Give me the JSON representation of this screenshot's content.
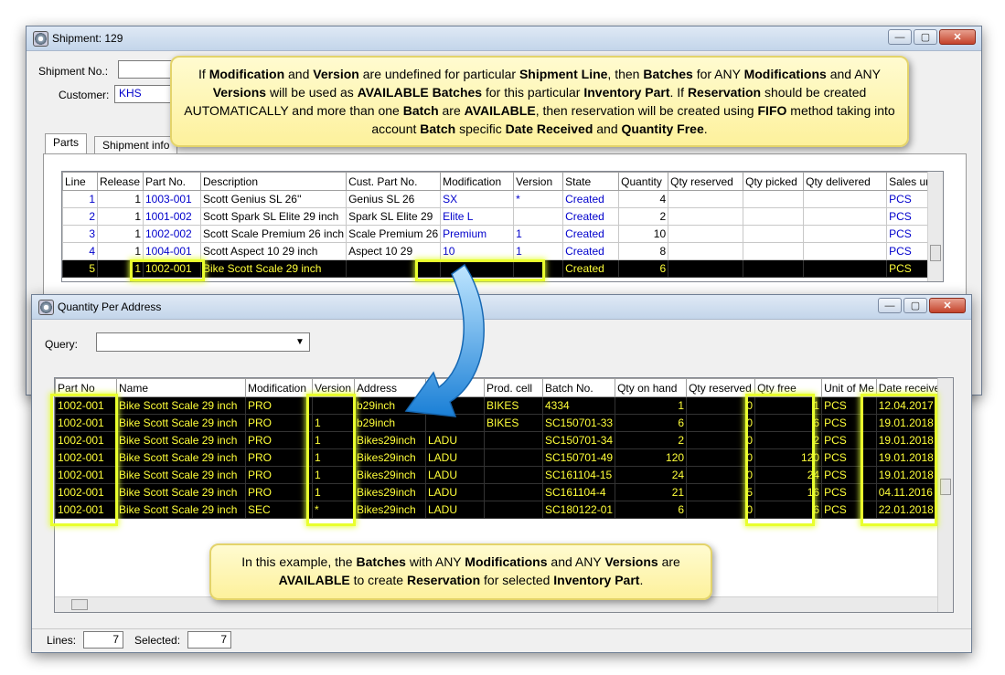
{
  "shipment": {
    "title": "Shipment: 129",
    "shipment_no_label": "Shipment No.:",
    "shipment_no_value": "129",
    "customer_label": "Customer:",
    "customer_value": "KHS",
    "tabs": [
      "Parts",
      "Shipment info"
    ],
    "columns": [
      "Line",
      "Release",
      "Part No.",
      "Description",
      "Cust. Part No.",
      "Modification",
      "Version",
      "State",
      "Quantity",
      "Qty reserved",
      "Qty picked",
      "Qty delivered",
      "Sales unit"
    ],
    "rows": [
      {
        "line": "1",
        "release": "1",
        "part": "1003-001",
        "desc": "Scott Genius SL 26''",
        "cust": "Genius SL 26",
        "mod": "SX",
        "ver": "*",
        "state": "Created",
        "qty": "4",
        "unit": "PCS"
      },
      {
        "line": "2",
        "release": "1",
        "part": "1001-002",
        "desc": "Scott Spark SL Elite 29 inch",
        "cust": "Spark SL Elite 29",
        "mod": "Elite L",
        "ver": "",
        "state": "Created",
        "qty": "2",
        "unit": "PCS"
      },
      {
        "line": "3",
        "release": "1",
        "part": "1002-002",
        "desc": "Scott Scale Premium 26 inch",
        "cust": "Scale Premium 26",
        "mod": "Premium",
        "ver": "1",
        "state": "Created",
        "qty": "10",
        "unit": "PCS"
      },
      {
        "line": "4",
        "release": "1",
        "part": "1004-001",
        "desc": "Scott Aspect 10 29 inch",
        "cust": "Aspect 10 29",
        "mod": "10",
        "ver": "1",
        "state": "Created",
        "qty": "8",
        "unit": "PCS"
      },
      {
        "line": "5",
        "release": "1",
        "part": "1002-001",
        "desc": "Bike Scott Scale 29 inch",
        "cust": "",
        "mod": "",
        "ver": "",
        "state": "Created",
        "qty": "6",
        "unit": "PCS"
      }
    ]
  },
  "qpa": {
    "title": "Quantity Per Address",
    "query_label": "Query:",
    "query_value": "",
    "columns": [
      "Part No",
      "Name",
      "Modification",
      "Version",
      "Address",
      "",
      "Prod. cell",
      "Batch No.",
      "Qty on hand",
      "Qty reserved",
      "Qty free",
      "Unit of Me",
      "Date received"
    ],
    "rows": [
      {
        "part": "1002-001",
        "name": "Bike Scott Scale 29 inch",
        "mod": "PRO",
        "ver": "",
        "addr": "b29inch",
        "loc": "",
        "cell": "BIKES",
        "batch": "4334",
        "onhand": "1",
        "res": "0",
        "free": "1",
        "unit": "PCS",
        "date": "12.04.2017"
      },
      {
        "part": "1002-001",
        "name": "Bike Scott Scale 29 inch",
        "mod": "PRO",
        "ver": "1",
        "addr": "b29inch",
        "loc": "",
        "cell": "BIKES",
        "batch": "SC150701-33",
        "onhand": "6",
        "res": "0",
        "free": "6",
        "unit": "PCS",
        "date": "19.01.2018"
      },
      {
        "part": "1002-001",
        "name": "Bike Scott Scale 29 inch",
        "mod": "PRO",
        "ver": "1",
        "addr": "Bikes29inch",
        "loc": "LADU",
        "cell": "",
        "batch": "SC150701-34",
        "onhand": "2",
        "res": "0",
        "free": "2",
        "unit": "PCS",
        "date": "19.01.2018"
      },
      {
        "part": "1002-001",
        "name": "Bike Scott Scale 29 inch",
        "mod": "PRO",
        "ver": "1",
        "addr": "Bikes29inch",
        "loc": "LADU",
        "cell": "",
        "batch": "SC150701-49",
        "onhand": "120",
        "res": "0",
        "free": "120",
        "unit": "PCS",
        "date": "19.01.2018"
      },
      {
        "part": "1002-001",
        "name": "Bike Scott Scale 29 inch",
        "mod": "PRO",
        "ver": "1",
        "addr": "Bikes29inch",
        "loc": "LADU",
        "cell": "",
        "batch": "SC161104-15",
        "onhand": "24",
        "res": "0",
        "free": "24",
        "unit": "PCS",
        "date": "19.01.2018"
      },
      {
        "part": "1002-001",
        "name": "Bike Scott Scale 29 inch",
        "mod": "PRO",
        "ver": "1",
        "addr": "Bikes29inch",
        "loc": "LADU",
        "cell": "",
        "batch": "SC161104-4",
        "onhand": "21",
        "res": "5",
        "free": "16",
        "unit": "PCS",
        "date": "04.11.2016"
      },
      {
        "part": "1002-001",
        "name": "Bike Scott Scale 29 inch",
        "mod": "SEC",
        "ver": "*",
        "addr": "Bikes29inch",
        "loc": "LADU",
        "cell": "",
        "batch": "SC180122-01",
        "onhand": "6",
        "res": "0",
        "free": "6",
        "unit": "PCS",
        "date": "22.01.2018"
      }
    ],
    "lines_label": "Lines:",
    "lines_value": "7",
    "selected_label": "Selected:",
    "selected_value": "7"
  },
  "callout_top": {
    "p1": "If ",
    "b1": "Modification",
    "p2": " and ",
    "b2": "Version",
    "p3": " are undefined for particular ",
    "b3": "Shipment Line",
    "p4": ", then ",
    "b4": "Batches",
    "p5": " for ANY ",
    "b5": "Modifications",
    "p6": " and ANY ",
    "b6": "Versions",
    "p7": " will be used as ",
    "b7": "AVAILABLE Batches",
    "p8": " for this particular ",
    "b8": "Inventory Part",
    "p9": ". If ",
    "b9": "Reservation",
    "p10": " should be created AUTOMATICALLY and more than one ",
    "b10": "Batch",
    "p11": " are ",
    "b11": "AVAILABLE",
    "p12": ", then reservation will be created using ",
    "b12": "FIFO",
    "p13": " method taking into account ",
    "b13": "Batch",
    "p14": " specific ",
    "b14": "Date Received",
    "p15": " and ",
    "b15": "Quantity Free",
    "p16": "."
  },
  "callout_bottom": {
    "p1": "In this example, the ",
    "b1": "Batches",
    "p2": " with ANY ",
    "b2": "Modifications",
    "p3": " and ANY ",
    "b3": "Versions",
    "p4": " are ",
    "b4": "AVAILABLE",
    "p5": " to create ",
    "b5": "Reservation",
    "p6": " for selected ",
    "b6": "Inventory Part",
    "p7": "."
  },
  "colors": {
    "highlight": "#e9ff2e",
    "selected_text": "#ffff3a",
    "link_blue": "#0000cc"
  }
}
